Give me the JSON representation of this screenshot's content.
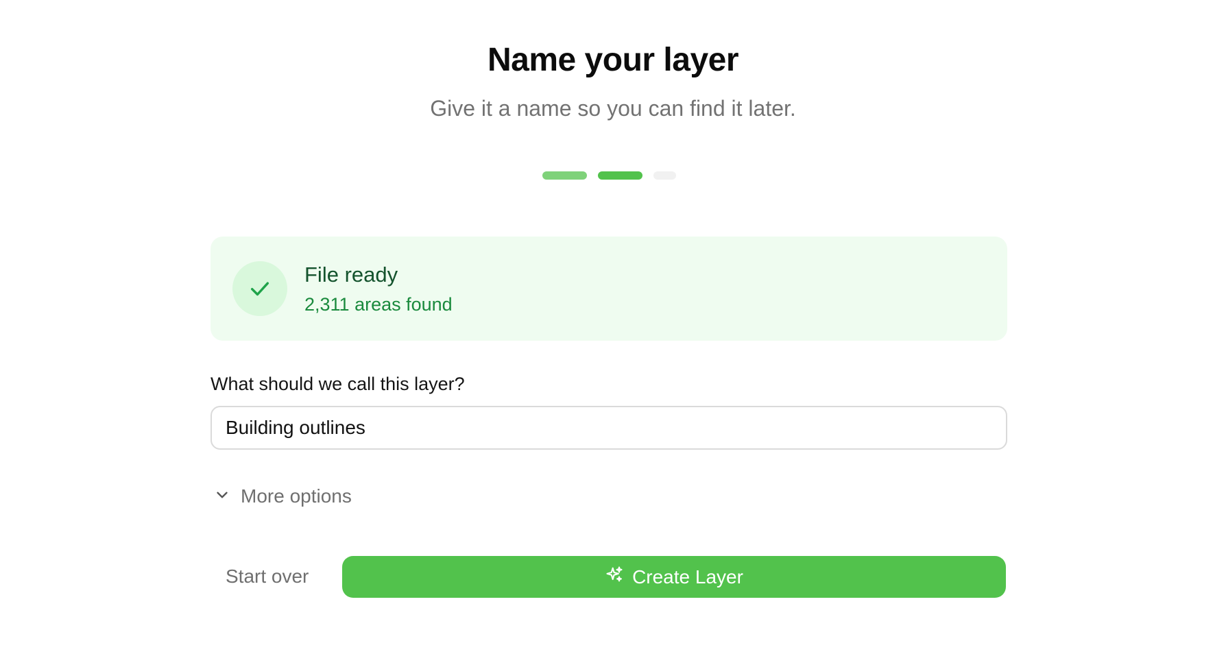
{
  "header": {
    "title": "Name your layer",
    "subtitle": "Give it a name so you can find it later."
  },
  "steps": {
    "total": 3,
    "current": 2,
    "colors": {
      "done": "#7fd27a",
      "active": "#52c24c",
      "pending": "#f1f1f1"
    }
  },
  "status_card": {
    "icon": "check-icon",
    "title": "File ready",
    "subtitle": "2,311 areas found",
    "background": "#effcf0",
    "accent": "#1a8a3d"
  },
  "form": {
    "label": "What should we call this layer?",
    "layer_name_value": "Building outlines"
  },
  "more_options": {
    "icon": "chevron-down-icon",
    "label": "More options"
  },
  "actions": {
    "start_over_label": "Start over",
    "create_label": "Create Layer",
    "create_icon": "sparkles-icon",
    "primary_color": "#52c24c"
  }
}
